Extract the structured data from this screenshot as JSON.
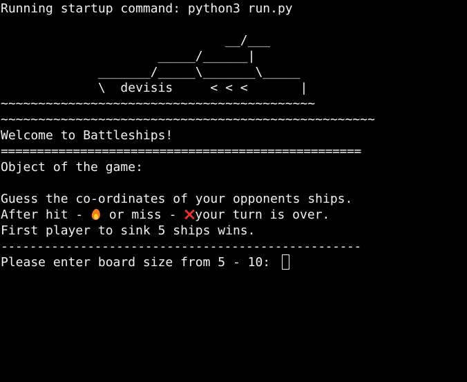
{
  "terminal": {
    "startup_line": "Running startup command: python3 run.py",
    "art": {
      "line1": "                              __/___",
      "line2": "                     _____/______|",
      "line3": "             _______/_____\\_______\\_____",
      "line4": "             \\  devisis     < < <       |",
      "line5": "~~~~~~~~~~~~~~~~~~~~~~~~~~~~~~~~~~~~~~~~~~",
      "line6": "~~~~~~~~~~~~~~~~~~~~~~~~~~~~~~~~~~~~~~~~~~~~~~~~~~"
    },
    "welcome": "Welcome to Battleships!",
    "equals_separator": "==================================================",
    "object_heading": "Object of the game:",
    "rules": {
      "line1": "Guess the co-ordinates of your opponents ships.",
      "line2_prefix": "After hit - ",
      "hit_icon": "fire-icon",
      "line2_middle": " or miss - ",
      "miss_icon": "cross-icon",
      "line2_suffix": "your turn is over.",
      "line3": "First player to sink 5 ships wins."
    },
    "dash_separator": "--------------------------------------------------",
    "prompt": "Please enter board size from 5 - 10: ",
    "input_value": ""
  }
}
